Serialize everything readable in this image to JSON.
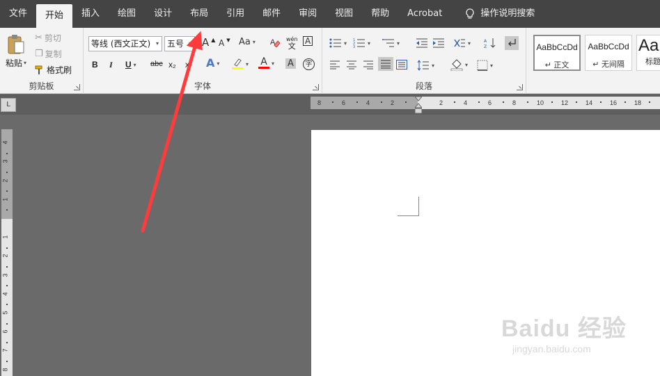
{
  "tabs": [
    {
      "id": "file",
      "label": "文件"
    },
    {
      "id": "home",
      "label": "开始",
      "active": true
    },
    {
      "id": "insert",
      "label": "插入"
    },
    {
      "id": "draw",
      "label": "绘图"
    },
    {
      "id": "design",
      "label": "设计"
    },
    {
      "id": "layout",
      "label": "布局"
    },
    {
      "id": "references",
      "label": "引用"
    },
    {
      "id": "mailings",
      "label": "邮件"
    },
    {
      "id": "review",
      "label": "审阅"
    },
    {
      "id": "view",
      "label": "视图"
    },
    {
      "id": "help",
      "label": "帮助"
    },
    {
      "id": "acrobat",
      "label": "Acrobat"
    }
  ],
  "tell_me": {
    "label": "操作说明搜索",
    "icon": "lightbulb-icon"
  },
  "clipboard": {
    "group_label": "剪贴板",
    "paste": "粘贴",
    "cut": "剪切",
    "copy": "复制",
    "format_painter": "格式刷"
  },
  "font": {
    "group_label": "字体",
    "font_name": "等线 (西文正文)",
    "font_size": "五号",
    "bold": "B",
    "italic": "I",
    "underline": "U",
    "strikethrough": "abc",
    "subscript": "x₂",
    "superscript": "x²",
    "change_case": "Aa",
    "grow": "A",
    "shrink": "A",
    "phonetic": "wén",
    "char_border": "A",
    "text_effects": "A",
    "font_color": "A",
    "char_shading": "A",
    "enclose": "字",
    "highlight_color": "#ffff00",
    "font_color_value": "#ff0000"
  },
  "paragraph": {
    "group_label": "段落"
  },
  "styles": {
    "items": [
      {
        "sample": "AaBbCcDd",
        "name": "↵ 正文",
        "selected": true
      },
      {
        "sample": "AaBbCcDd",
        "name": "↵ 无间隔",
        "selected": false
      },
      {
        "sample": "Aa",
        "name": "标题",
        "selected": false
      }
    ]
  },
  "ruler": {
    "h_labels": [
      "8",
      "6",
      "4",
      "2",
      "2",
      "4",
      "6",
      "8",
      "10",
      "12",
      "14",
      "16",
      "18"
    ],
    "v_labels": [
      "4",
      "3",
      "2",
      "1",
      "1",
      "2",
      "3",
      "4",
      "5",
      "6",
      "7",
      "8"
    ],
    "corner_symbol": "L"
  },
  "watermark": {
    "line1": "Baidu 经验",
    "line2": "jingyan.baidu.com"
  },
  "annotation": {
    "arrow_color": "#ff3b3b"
  }
}
